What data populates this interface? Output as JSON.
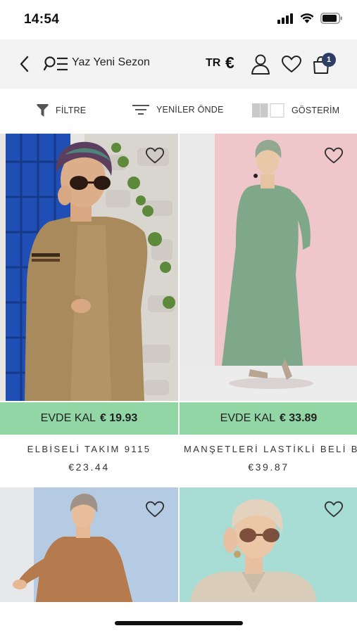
{
  "status": {
    "time": "14:54"
  },
  "header": {
    "title": "Yaz Yeni Sezon",
    "language": "TR",
    "currency_symbol": "€",
    "cart_count": "1"
  },
  "filterbar": {
    "filter_label": "FİLTRE",
    "sort_label": "YENİLER ÖNDE",
    "view_label": "GÖSTERİM"
  },
  "products": [
    {
      "promo_label": "EVDE KAL",
      "promo_price": "€ 19.93",
      "name": "ELBİSELİ TAKIM 9115",
      "price": "€23.44"
    },
    {
      "promo_label": "EVDE KAL",
      "promo_price": "€ 33.89",
      "name": "MANŞETLERİ LASTİKLİ BELİ B",
      "price": "€39.87"
    },
    {
      "promo_label": "",
      "promo_price": "",
      "name": "",
      "price": ""
    },
    {
      "promo_label": "",
      "promo_price": "",
      "name": "",
      "price": ""
    }
  ],
  "colors": {
    "promo_bg": "#93d6a5",
    "header_bg": "#f3f3f3",
    "badge_bg": "#2c3e66"
  },
  "icons": [
    "back-icon",
    "search-menu-icon",
    "user-icon",
    "heart-icon",
    "bag-icon",
    "funnel-icon",
    "sort-icon",
    "grid-view-icon"
  ]
}
